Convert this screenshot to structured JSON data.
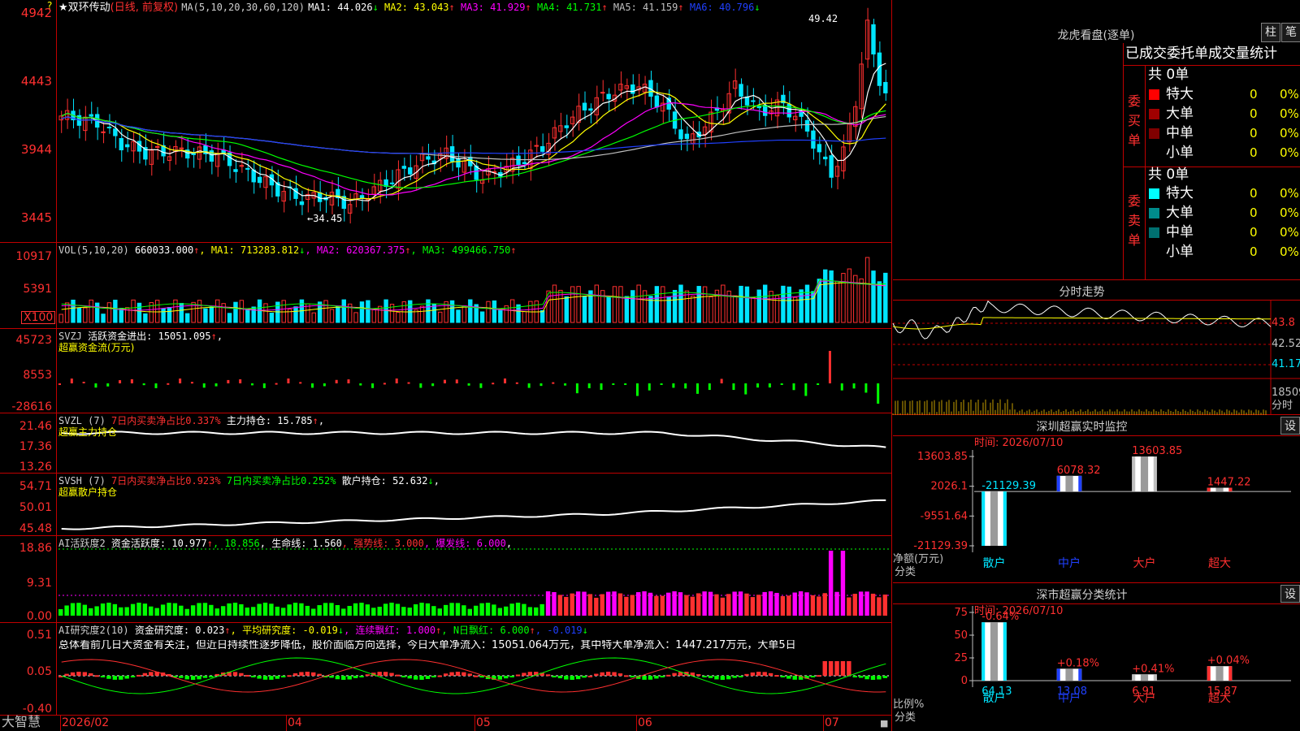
{
  "colors": {
    "up": "#ff3030",
    "down": "#00e5ff",
    "grid": "#c00000",
    "ma1": "#ffffff",
    "ma2": "#ffff00",
    "ma3": "#ff00ff",
    "ma4": "#00ff00",
    "ma5": "#c0c0c0",
    "ma6": "#2040ff",
    "green": "#00ff00",
    "magenta": "#ff00ff",
    "yellow": "#ffff00"
  },
  "app": {
    "corner_mark": "?",
    "brand": "大智慧"
  },
  "kline": {
    "star": "★",
    "stock_name": "双环传动",
    "period": "(日线, 前复权)",
    "ma_params": "MA(5,10,20,30,60,120)",
    "ma_items": [
      {
        "label": "MA1:",
        "value": "44.026",
        "arrow": "↓"
      },
      {
        "label": "MA2:",
        "value": "43.043",
        "arrow": "↑"
      },
      {
        "label": "MA3:",
        "value": "41.929",
        "arrow": "↑"
      },
      {
        "label": "MA4:",
        "value": "41.731",
        "arrow": "↑"
      },
      {
        "label": "MA5:",
        "value": "41.159",
        "arrow": "↑"
      },
      {
        "label": "MA6:",
        "value": "40.796",
        "arrow": "↓"
      }
    ],
    "yticks": [
      "4942",
      "4443",
      "3944",
      "3445"
    ],
    "high_label": "49.42",
    "low_label": "←34.45"
  },
  "vol": {
    "title": "VOL(5,10,20)",
    "value": "660033.000",
    "value_arrow": "↑",
    "items": [
      {
        "label": "MA1:",
        "value": "713283.812",
        "arrow": "↓"
      },
      {
        "label": "MA2:",
        "value": "620367.375",
        "arrow": "↑"
      },
      {
        "label": "MA3:",
        "value": "499466.750",
        "arrow": "↑"
      }
    ],
    "yticks": [
      "10917",
      "5391"
    ],
    "unit": "X100"
  },
  "svzj": {
    "title": "SVZJ",
    "text1": "活跃资金进出: 15051.095",
    "arrow1": "↑",
    "comma": ",",
    "text2": "超赢资金流(万元)",
    "yticks": [
      "45723",
      "8553",
      "-28616"
    ]
  },
  "svzl": {
    "title": "SVZL (7)",
    "text1": "7日内买卖净占比0.337%",
    "text2": "主力持仓: 15.785",
    "arrow2": "↑",
    "comma": ",",
    "text3": "超赢主力持仓",
    "yticks": [
      "21.46",
      "17.36",
      "13.26"
    ]
  },
  "svsh": {
    "title": "SVSH (7)",
    "text1": "7日内买卖净占比0.923%",
    "text2": "7日内买卖净占比0.252%",
    "text3": "散户持仓: 52.632",
    "arrow3": "↓",
    "comma": ",",
    "text4": "超赢散户持仓",
    "yticks": [
      "54.71",
      "50.01",
      "45.48"
    ]
  },
  "aiact": {
    "title": "AI活跃度2",
    "text1": "资金活跃度: 10.977",
    "arrow1": "↑",
    "text2": ", 18.856",
    "text3": ", 生命线: 1.560",
    "text4": ", 强势线: 3.000",
    "text5": ", 爆发线: 6.000",
    "text6": ",",
    "yticks": [
      "18.86",
      "9.31",
      "0.00"
    ]
  },
  "airesearch": {
    "title": "AI研究度2(10)",
    "text1": "资金研究度: 0.023",
    "arrow1": "↑",
    "text2": ", 平均研究度: -0.019",
    "arrow2": "↓",
    "text3": ", 连续飘红: 1.000",
    "arrow3": "↑",
    "text4": ", N日飘红: 6.000",
    "arrow4": "↑",
    "text5": ", -0.019",
    "arrow5": "↓",
    "summary": "总体看前几日大资金有关注，但近日持续性逐步降低，股价面临方向选择，今日大单净流入：15051.064万元，其中特大单净流入：1447.217万元，大单5日",
    "yticks": [
      "0.51",
      "0.05",
      "-0.40"
    ]
  },
  "xaxis": {
    "labels": [
      "2026/02",
      "04",
      "05",
      "06",
      "07"
    ]
  },
  "lhb": {
    "title": "龙虎看盘(逐单)",
    "btn1": "柱",
    "btn2": "笔",
    "header": "已成交委托单成交量统计",
    "buy_label": "委买单",
    "sell_label": "委卖单",
    "buy_total": "共 0单",
    "sell_total": "共 0单",
    "buy_rows": [
      {
        "name": "特大",
        "count": "0",
        "pct": "0%",
        "color": "#ff0000"
      },
      {
        "name": "大单",
        "count": "0",
        "pct": "0%",
        "color": "#a00000"
      },
      {
        "name": "中单",
        "count": "0",
        "pct": "0%",
        "color": "#800000"
      },
      {
        "name": "小单",
        "count": "0",
        "pct": "0%",
        "color": ""
      }
    ],
    "sell_rows": [
      {
        "name": "特大",
        "count": "0",
        "pct": "0%",
        "color": "#00ffff"
      },
      {
        "name": "大单",
        "count": "0",
        "pct": "0%",
        "color": "#008b8b"
      },
      {
        "name": "中单",
        "count": "0",
        "pct": "0%",
        "color": "#007070"
      },
      {
        "name": "小单",
        "count": "0",
        "pct": "0%",
        "color": ""
      }
    ]
  },
  "intraday": {
    "title": "分时走势",
    "yticks": [
      "43.8",
      "42.52",
      "41.17"
    ],
    "vol_tick": "18509",
    "vol_unit": "分时"
  },
  "sz_monitor": {
    "title": "深圳超赢实时监控",
    "btn": "设",
    "time": "时间: 2026/07/10",
    "yticks": [
      "13603.85",
      "2026.1",
      "-9551.64",
      "-21129.39"
    ],
    "ylabel_1": "净额(万元)",
    "ylabel_2": "分类",
    "cats": [
      "散户",
      "中户",
      "大户",
      "超大"
    ],
    "values": [
      -21129.39,
      6078.32,
      13603.85,
      1447.22
    ],
    "value_labels": [
      "-21129.39",
      "6078.32",
      "13603.85",
      "1447.22"
    ]
  },
  "sz_class": {
    "title": "深市超赢分类统计",
    "btn": "设",
    "time": "时间: 2026/07/10",
    "yticks": [
      "75",
      "50",
      "25",
      "0"
    ],
    "ylabel_1": "比例%",
    "ylabel_2": "分类",
    "cats": [
      "散户",
      "中户",
      "大户",
      "超大"
    ],
    "values": [
      64.13,
      13.08,
      6.91,
      15.87
    ],
    "value_labels": [
      "64.13",
      "13.08",
      "6.91",
      "15.87"
    ],
    "change_labels": [
      "-0.64%",
      "+0.18%",
      "+0.41%",
      "+0.04%"
    ]
  }
}
